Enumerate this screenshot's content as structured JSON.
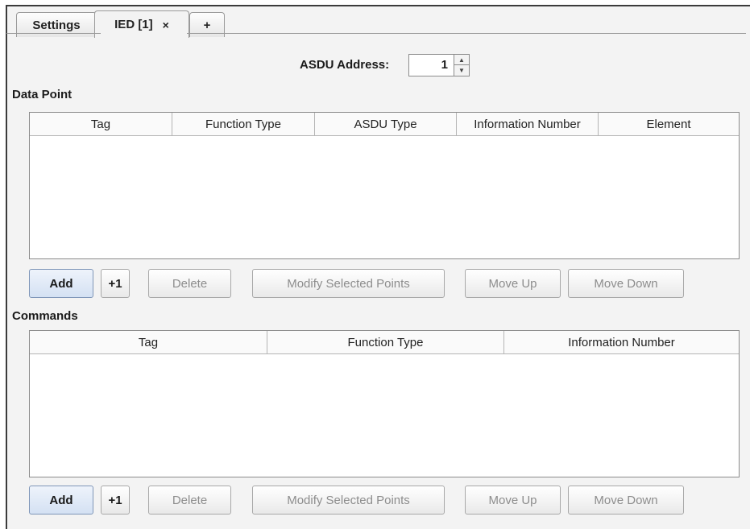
{
  "tabs": [
    {
      "label": "Settings"
    },
    {
      "label": "IED [1]",
      "close": "×"
    },
    {
      "label": "+"
    }
  ],
  "asdu": {
    "label": "ASDU Address:",
    "value": "1"
  },
  "data_point": {
    "title": "Data Point",
    "columns": [
      "Tag",
      "Function Type",
      "ASDU Type",
      "Information Number",
      "Element"
    ],
    "rows": []
  },
  "commands": {
    "title": "Commands",
    "columns": [
      "Tag",
      "Function Type",
      "Information Number"
    ],
    "rows": []
  },
  "buttons": {
    "add": "Add",
    "plus_one": "+1",
    "delete": "Delete",
    "modify": "Modify Selected Points",
    "move_up": "Move Up",
    "move_down": "Move Down"
  }
}
